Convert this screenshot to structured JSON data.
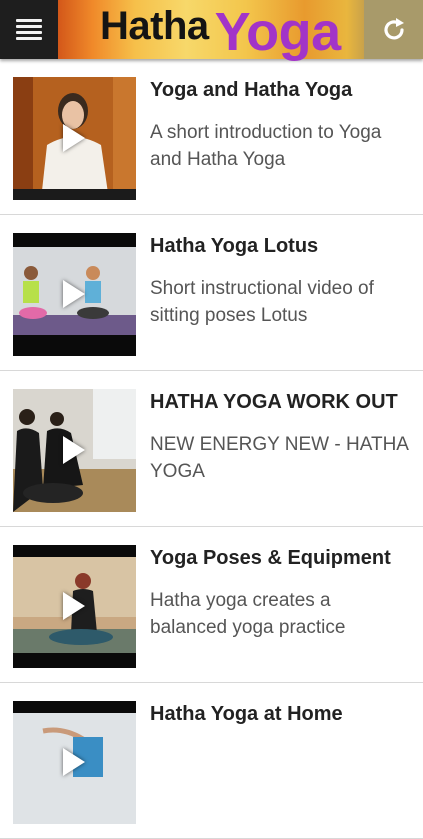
{
  "header": {
    "logo_word1": "Hatha",
    "logo_word2": "Yoga",
    "menu_icon": "hamburger-menu-icon",
    "refresh_icon": "refresh-icon"
  },
  "videos": [
    {
      "title": "Yoga and Hatha Yoga",
      "description": "A short introduction to Yoga and Hatha Yoga"
    },
    {
      "title": "Hatha Yoga Lotus",
      "description": "Short instructional video of sitting poses Lotus"
    },
    {
      "title": "HATHA YOGA WORK OUT",
      "description": "NEW ENERGY NEW - HATHA YOGA"
    },
    {
      "title": "Yoga Poses & Equipment",
      "description": "Hatha yoga creates a balanced yoga practice"
    },
    {
      "title": "Hatha Yoga at Home",
      "description": ""
    }
  ],
  "colors": {
    "logo_accent": "#a234c8",
    "header_left": "#1e1e1e",
    "header_right": "#a89a6a"
  }
}
